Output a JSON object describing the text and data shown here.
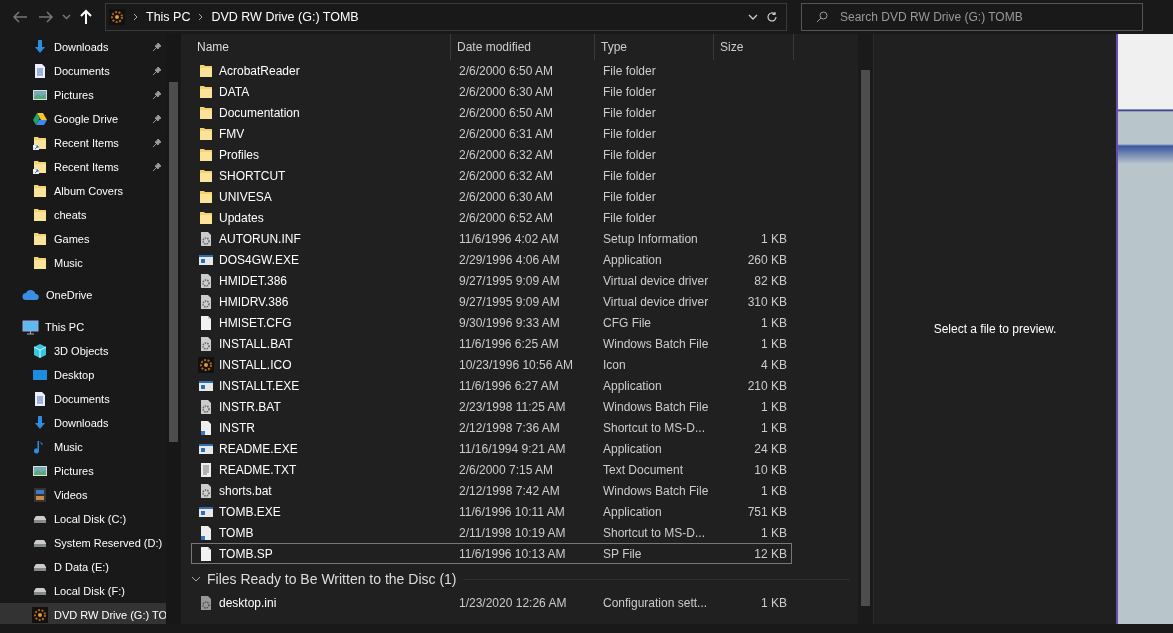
{
  "address": {
    "crumbs": [
      "This PC",
      "DVD RW Drive (G:) TOMB"
    ]
  },
  "search": {
    "placeholder": "Search DVD RW Drive (G:) TOMB"
  },
  "quick_access": [
    {
      "label": "Downloads",
      "kind": "download",
      "pinned": true
    },
    {
      "label": "Documents",
      "kind": "document",
      "pinned": true
    },
    {
      "label": "Pictures",
      "kind": "pictures",
      "pinned": true
    },
    {
      "label": "Google Drive",
      "kind": "gdrive",
      "pinned": true
    },
    {
      "label": "Recent Items",
      "kind": "recent",
      "pinned": true
    },
    {
      "label": "Recent Items",
      "kind": "recent",
      "pinned": true
    },
    {
      "label": "Album Covers",
      "kind": "folder",
      "pinned": false
    },
    {
      "label": "cheats",
      "kind": "folder",
      "pinned": false
    },
    {
      "label": "Games",
      "kind": "folder",
      "pinned": false
    },
    {
      "label": "Music",
      "kind": "folder",
      "pinned": false
    }
  ],
  "onedrive": {
    "label": "OneDrive"
  },
  "this_pc": {
    "label": "This PC",
    "children": [
      {
        "label": "3D Objects",
        "kind": "cube",
        "selected": false
      },
      {
        "label": "Desktop",
        "kind": "desktop",
        "selected": false
      },
      {
        "label": "Documents",
        "kind": "document",
        "selected": false
      },
      {
        "label": "Downloads",
        "kind": "download",
        "selected": false
      },
      {
        "label": "Music",
        "kind": "music",
        "selected": false
      },
      {
        "label": "Pictures",
        "kind": "pictures",
        "selected": false
      },
      {
        "label": "Videos",
        "kind": "video",
        "selected": false
      },
      {
        "label": "Local Disk (C:)",
        "kind": "disk",
        "selected": false
      },
      {
        "label": "System Reserved (D:)",
        "kind": "disk",
        "selected": false
      },
      {
        "label": "D Data (E:)",
        "kind": "disk",
        "selected": false
      },
      {
        "label": "Local Disk (F:)",
        "kind": "disk",
        "selected": false
      },
      {
        "label": "DVD RW Drive (G:) TO",
        "kind": "dvd",
        "selected": true
      }
    ]
  },
  "table": {
    "columns": [
      "Name",
      "Date modified",
      "Type",
      "Size"
    ],
    "rows": [
      {
        "name": "AcrobatReader",
        "date": "2/6/2000 6:50 AM",
        "type": "File folder",
        "kind": "folder",
        "selected": false
      },
      {
        "name": "DATA",
        "date": "2/6/2000 6:30 AM",
        "type": "File folder",
        "kind": "folder",
        "selected": false
      },
      {
        "name": "Documentation",
        "date": "2/6/2000 6:50 AM",
        "type": "File folder",
        "kind": "folder",
        "selected": false
      },
      {
        "name": "FMV",
        "date": "2/6/2000 6:31 AM",
        "type": "File folder",
        "kind": "folder",
        "selected": false
      },
      {
        "name": "Profiles",
        "date": "2/6/2000 6:32 AM",
        "type": "File folder",
        "kind": "folder",
        "selected": false
      },
      {
        "name": "SHORTCUT",
        "date": "2/6/2000 6:32 AM",
        "type": "File folder",
        "kind": "folder",
        "selected": false
      },
      {
        "name": "UNIVESA",
        "date": "2/6/2000 6:30 AM",
        "type": "File folder",
        "kind": "folder",
        "selected": false
      },
      {
        "name": "Updates",
        "date": "2/6/2000 6:52 AM",
        "type": "File folder",
        "kind": "folder",
        "selected": false
      },
      {
        "name": "AUTORUN.INF",
        "date": "11/6/1996 4:02 AM",
        "type": "Setup Information",
        "size": "1 KB",
        "kind": "gearfile",
        "selected": false
      },
      {
        "name": "DOS4GW.EXE",
        "date": "2/29/1996 4:06 AM",
        "type": "Application",
        "size": "260 KB",
        "kind": "app",
        "selected": false
      },
      {
        "name": "HMIDET.386",
        "date": "9/27/1995 9:09 AM",
        "type": "Virtual device driver",
        "size": "82 KB",
        "kind": "gearfile",
        "selected": false
      },
      {
        "name": "HMIDRV.386",
        "date": "9/27/1995 9:09 AM",
        "type": "Virtual device driver",
        "size": "310 KB",
        "kind": "gearfile",
        "selected": false
      },
      {
        "name": "HMISET.CFG",
        "date": "9/30/1996 9:33 AM",
        "type": "CFG File",
        "size": "1 KB",
        "kind": "blank",
        "selected": false
      },
      {
        "name": "INSTALL.BAT",
        "date": "11/6/1996 6:25 AM",
        "type": "Windows Batch File",
        "size": "1 KB",
        "kind": "batch",
        "selected": false
      },
      {
        "name": "INSTALL.ICO",
        "date": "10/23/1996 10:56 AM",
        "type": "Icon",
        "size": "4 KB",
        "kind": "ring",
        "selected": false
      },
      {
        "name": "INSTALLT.EXE",
        "date": "11/6/1996 6:27 AM",
        "type": "Application",
        "size": "210 KB",
        "kind": "app",
        "selected": false
      },
      {
        "name": "INSTR.BAT",
        "date": "2/23/1998 11:25 AM",
        "type": "Windows Batch File",
        "size": "1 KB",
        "kind": "batch",
        "selected": false
      },
      {
        "name": "INSTR",
        "date": "2/12/1998 7:36 AM",
        "type": "Shortcut to MS-D...",
        "size": "1 KB",
        "kind": "shortcut",
        "selected": false
      },
      {
        "name": "README.EXE",
        "date": "11/16/1994 9:21 AM",
        "type": "Application",
        "size": "24 KB",
        "kind": "app",
        "selected": false
      },
      {
        "name": "README.TXT",
        "date": "2/6/2000 7:15 AM",
        "type": "Text Document",
        "size": "10 KB",
        "kind": "text",
        "selected": false
      },
      {
        "name": "shorts.bat",
        "date": "2/12/1998 7:42 AM",
        "type": "Windows Batch File",
        "size": "1 KB",
        "kind": "batch",
        "selected": false
      },
      {
        "name": "TOMB.EXE",
        "date": "11/6/1996 10:11 AM",
        "type": "Application",
        "size": "751 KB",
        "kind": "app",
        "selected": false
      },
      {
        "name": "TOMB",
        "date": "2/11/1998 10:19 AM",
        "type": "Shortcut to MS-D...",
        "size": "1 KB",
        "kind": "shortcut",
        "selected": false
      },
      {
        "name": "TOMB.SP",
        "date": "11/6/1996 10:13 AM",
        "type": "SP File",
        "size": "12 KB",
        "kind": "blank",
        "selected": true
      }
    ]
  },
  "group": {
    "title": "Files Ready to Be Written to the Disc (1)",
    "expanded": true,
    "rows": [
      {
        "name": "desktop.ini",
        "date": "1/23/2020 12:26 AM",
        "type": "Configuration sett...",
        "size": "1 KB",
        "kind": "gearfile",
        "selected": false
      }
    ]
  },
  "preview": {
    "message": "Select a file to preview."
  }
}
